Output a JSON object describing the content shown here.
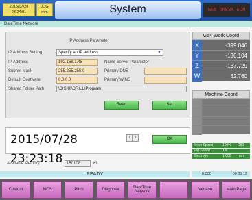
{
  "header": {
    "date": "2015/07/28",
    "time": "23.24:01",
    "mode_line1": "JOG",
    "mode_line2": "mm",
    "title": "System",
    "alarm": "NEB DNE3A EDN"
  },
  "subtitle": "DateTime Network",
  "ip_panel": {
    "title": "IP Address Parameter",
    "setting_label": "IP Address Setting",
    "setting_value": "Specify an IP address",
    "ip_label": "IP Address",
    "ip_value": "192.168.1.48",
    "name_server_label": "Name Server Parameter",
    "subnet_label": "Subnet Mask",
    "subnet_value": "255.255.255.0",
    "primary_dns_label": "Primary DNS",
    "primary_dns_value": "",
    "gateway_label": "Default Geatware",
    "gateway_value": "0.0.0.0",
    "primary_wins_label": "Primary WINS",
    "primary_wins_value": "",
    "shared_folder_label": "Shared Folder Path",
    "shared_folder_value": "\\DISK0\\DRILL\\Program",
    "read_label": "Read",
    "set_label": "Set"
  },
  "clock": {
    "value": "2015/07/28 23:23:18",
    "ok_label": "OK"
  },
  "memory": {
    "label": "Available Memory",
    "value": "150108",
    "unit": "Kb"
  },
  "status": {
    "ready": "READY",
    "left_value": "0.000",
    "right_value": "00:05:19"
  },
  "work_coord": {
    "title": "G54 Work Coord",
    "rows": [
      {
        "axis": "X",
        "value": "-399.046"
      },
      {
        "axis": "Y",
        "value": "-136.104"
      },
      {
        "axis": "Z",
        "value": "-137.729"
      },
      {
        "axis": "W",
        "value": "32.760"
      }
    ]
  },
  "machine_coord": {
    "title": "Machine Coord",
    "rows": [
      {
        "axis": "",
        "value": ""
      },
      {
        "axis": "",
        "value": ""
      },
      {
        "axis": "",
        "value": ""
      },
      {
        "axis": "",
        "value": ""
      }
    ]
  },
  "speeds": {
    "move_label": "Move Speed",
    "move_pct": "100%",
    "move_val": "D80",
    "jog_label": "Jog Speed",
    "jog_pct": "1%",
    "jog_val": "",
    "electrode_label": "Electrode",
    "electrode_val": "1.000",
    "electrode_unit": "mm"
  },
  "function_keys": [
    "Custom",
    "MCS",
    "Pitch",
    "Diagnose",
    "DateTime Network",
    "",
    "Version",
    "Main Page"
  ],
  "colors": {
    "accent": "#1c4fa6",
    "function_key": "#d27bcb",
    "ok_green": "#48b84a"
  }
}
